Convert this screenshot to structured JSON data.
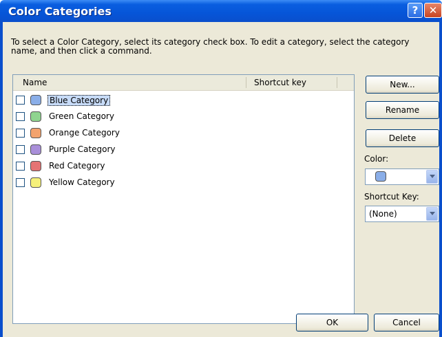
{
  "window": {
    "title": "Color Categories",
    "help_glyph": "?",
    "close_glyph": "✕"
  },
  "instructions": "To select a Color Category, select its category check box.  To edit a category, select the category name, and then click a command.",
  "list": {
    "columns": {
      "name": "Name",
      "shortcut": "Shortcut key"
    },
    "items": [
      {
        "label": "Blue Category",
        "color": "#8aaee8",
        "checked": false,
        "selected": true
      },
      {
        "label": "Green Category",
        "color": "#8fd48f",
        "checked": false,
        "selected": false
      },
      {
        "label": "Orange Category",
        "color": "#f3a36e",
        "checked": false,
        "selected": false
      },
      {
        "label": "Purple Category",
        "color": "#a98fd9",
        "checked": false,
        "selected": false
      },
      {
        "label": "Red Category",
        "color": "#e57373",
        "checked": false,
        "selected": false
      },
      {
        "label": "Yellow Category",
        "color": "#f5f07a",
        "checked": false,
        "selected": false
      }
    ]
  },
  "buttons": {
    "new": "New...",
    "rename": "Rename",
    "delete": "Delete",
    "ok": "OK",
    "cancel": "Cancel"
  },
  "color": {
    "label": "Color:",
    "value_color": "#8aaee8"
  },
  "shortcut_key": {
    "label": "Shortcut Key:",
    "value": "(None)"
  }
}
